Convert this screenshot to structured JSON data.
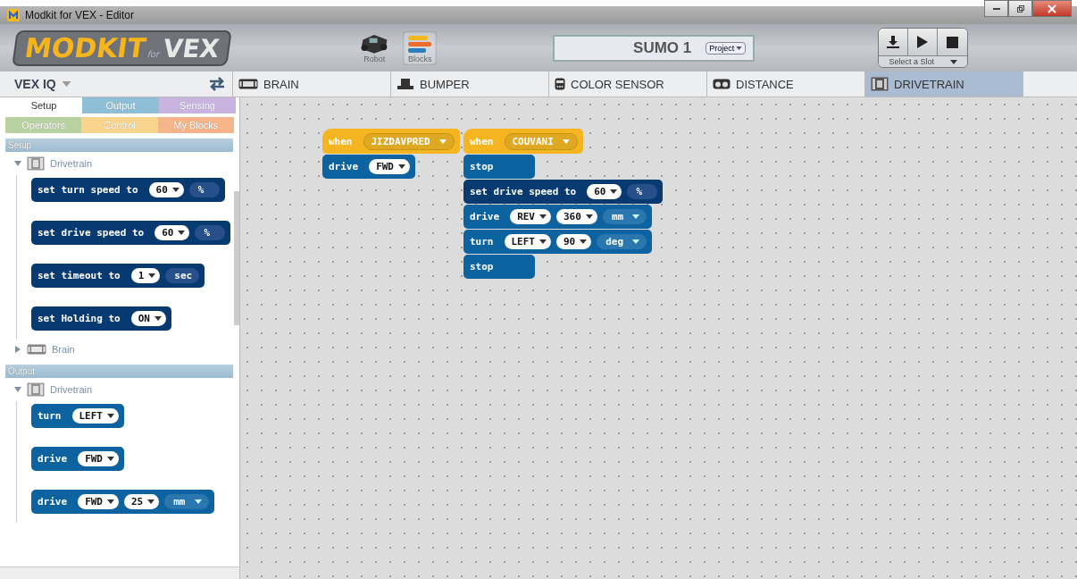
{
  "window": {
    "title": "Modkit for VEX - Editor"
  },
  "logo": {
    "main": "MODKIT",
    "sub": "for",
    "brand": "VEX"
  },
  "modes": [
    {
      "label": "Robot",
      "kind": "robot",
      "selected": false
    },
    {
      "label": "Blocks",
      "kind": "blocks",
      "selected": true
    }
  ],
  "project": {
    "name": "SUMO 1",
    "menu": "Project"
  },
  "run_controls": {
    "slot": "Select a Slot"
  },
  "platform": {
    "label": "VEX IQ"
  },
  "devices": [
    {
      "label": "BRAIN",
      "kind": "brain",
      "selected": false
    },
    {
      "label": "BUMPER",
      "kind": "bumper",
      "selected": false
    },
    {
      "label": "COLOR SENSOR",
      "kind": "color",
      "selected": false
    },
    {
      "label": "DISTANCE",
      "kind": "distance",
      "selected": false
    },
    {
      "label": "DRIVETRAIN",
      "kind": "drivetrain",
      "selected": true
    }
  ],
  "category_tabs": [
    [
      {
        "label": "Setup",
        "color": "#ffffff",
        "selected": true
      },
      {
        "label": "Output",
        "color": "#8fbfd6",
        "selected": false
      },
      {
        "label": "Sensing",
        "color": "#c9b3df",
        "selected": false
      }
    ],
    [
      {
        "label": "Operators",
        "color": "#b9d3a0",
        "selected": false
      },
      {
        "label": "Control",
        "color": "#f9d48e",
        "selected": false
      },
      {
        "label": "My Blocks",
        "color": "#f6b48a",
        "selected": false
      }
    ]
  ],
  "palette": [
    {
      "title": "Setup",
      "groups": [
        {
          "label": "Drivetrain",
          "kind": "drivetrain",
          "expanded": true,
          "blocks": [
            {
              "kind": "setup",
              "parts": [
                {
                  "kind": "label",
                  "text": "set turn speed to"
                },
                {
                  "kind": "dropdown",
                  "text": "60"
                },
                {
                  "kind": "unit",
                  "text": "%",
                  "menu": false
                }
              ]
            },
            {
              "kind": "setup",
              "parts": [
                {
                  "kind": "label",
                  "text": "set drive speed to"
                },
                {
                  "kind": "dropdown",
                  "text": "60"
                },
                {
                  "kind": "unit",
                  "text": "%",
                  "menu": false
                }
              ]
            },
            {
              "kind": "setup",
              "parts": [
                {
                  "kind": "label",
                  "text": "set timeout to"
                },
                {
                  "kind": "dropdown",
                  "text": "1"
                },
                {
                  "kind": "unit",
                  "text": "sec",
                  "menu": false
                }
              ]
            },
            {
              "kind": "setup",
              "parts": [
                {
                  "kind": "label",
                  "text": "set Holding to"
                },
                {
                  "kind": "dropdown",
                  "text": "ON"
                }
              ]
            }
          ]
        },
        {
          "label": "Brain",
          "kind": "brain",
          "expanded": false
        }
      ]
    },
    {
      "title": "Output",
      "groups": [
        {
          "label": "Drivetrain",
          "kind": "drivetrain",
          "expanded": true,
          "blocks": [
            {
              "kind": "action",
              "parts": [
                {
                  "kind": "label",
                  "text": "turn"
                },
                {
                  "kind": "dropdown",
                  "text": "LEFT"
                }
              ]
            },
            {
              "kind": "action",
              "parts": [
                {
                  "kind": "label",
                  "text": "drive"
                },
                {
                  "kind": "dropdown",
                  "text": "FWD"
                }
              ]
            },
            {
              "kind": "action",
              "parts": [
                {
                  "kind": "label",
                  "text": "drive"
                },
                {
                  "kind": "dropdown",
                  "text": "FWD"
                },
                {
                  "kind": "dropdown",
                  "text": "25"
                },
                {
                  "kind": "unit",
                  "text": "mm",
                  "menu": true
                }
              ]
            }
          ]
        }
      ]
    }
  ],
  "scripts": [
    {
      "blocks": [
        {
          "kind": "event",
          "parts": [
            {
              "kind": "label",
              "text": "when"
            },
            {
              "kind": "dropdown",
              "text": "JIZDAVPRED"
            }
          ]
        },
        {
          "kind": "action",
          "parts": [
            {
              "kind": "label",
              "text": "drive"
            },
            {
              "kind": "dropdown",
              "text": "FWD"
            }
          ]
        }
      ]
    },
    {
      "blocks": [
        {
          "kind": "event",
          "parts": [
            {
              "kind": "label",
              "text": "when"
            },
            {
              "kind": "dropdown",
              "text": "COUVANI"
            }
          ]
        },
        {
          "kind": "action",
          "parts": [
            {
              "kind": "label",
              "text": "stop"
            }
          ]
        },
        {
          "kind": "setup",
          "parts": [
            {
              "kind": "label",
              "text": "set drive speed to"
            },
            {
              "kind": "dropdown",
              "text": "60"
            },
            {
              "kind": "unit",
              "text": "%",
              "menu": false
            }
          ]
        },
        {
          "kind": "action",
          "parts": [
            {
              "kind": "label",
              "text": "drive"
            },
            {
              "kind": "dropdown",
              "text": "REV"
            },
            {
              "kind": "dropdown",
              "text": "360"
            },
            {
              "kind": "unit",
              "text": "mm",
              "menu": true
            }
          ]
        },
        {
          "kind": "action",
          "parts": [
            {
              "kind": "label",
              "text": "turn"
            },
            {
              "kind": "dropdown",
              "text": "LEFT"
            },
            {
              "kind": "dropdown",
              "text": "90"
            },
            {
              "kind": "unit",
              "text": "deg",
              "menu": true
            }
          ]
        },
        {
          "kind": "action",
          "parts": [
            {
              "kind": "label",
              "text": "stop"
            }
          ]
        }
      ]
    }
  ]
}
